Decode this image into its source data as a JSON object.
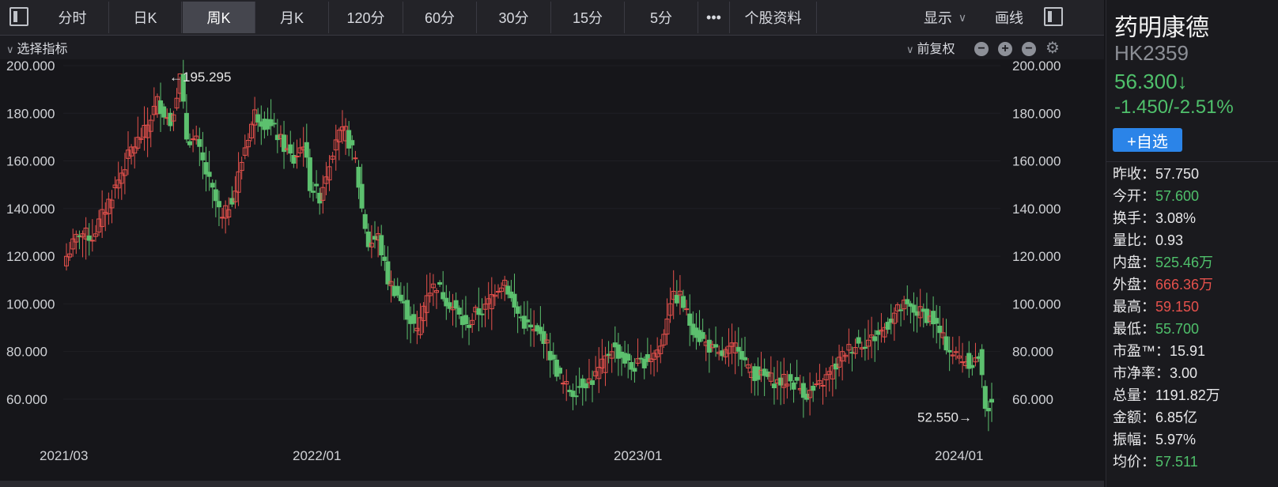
{
  "toolbar": {
    "tabs": [
      "分时",
      "日K",
      "周K",
      "月K",
      "120分",
      "60分",
      "30分",
      "15分",
      "5分"
    ],
    "active_tab": "周K",
    "more": "•••",
    "profile": "个股资料",
    "display": "显示",
    "draw": "画线"
  },
  "indicator_bar": {
    "select_label": "选择指标",
    "adjust_label": "前复权"
  },
  "stock": {
    "name": "药明康德",
    "code": "HK2359",
    "price": "56.300↓",
    "change": "-1.450/-2.51%",
    "watch_button": "+自选"
  },
  "quote_table": [
    {
      "label": "昨收",
      "value": "57.750",
      "color": "white"
    },
    {
      "label": "今开",
      "value": "57.600",
      "color": "green"
    },
    {
      "label": "换手",
      "value": "3.08%",
      "color": "white"
    },
    {
      "label": "量比",
      "value": "0.93",
      "color": "white"
    },
    {
      "label": "内盘",
      "value": "525.46万",
      "color": "green"
    },
    {
      "label": "外盘",
      "value": "666.36万",
      "color": "red"
    },
    {
      "label": "最高",
      "value": "59.150",
      "color": "red"
    },
    {
      "label": "最低",
      "value": "55.700",
      "color": "green"
    },
    {
      "label": "市盈™",
      "value": "15.91",
      "color": "white"
    },
    {
      "label": "市净率",
      "value": "3.00",
      "color": "white"
    },
    {
      "label": "总量",
      "value": "1191.82万",
      "color": "white"
    },
    {
      "label": "金额",
      "value": "6.85亿",
      "color": "white"
    },
    {
      "label": "振幅",
      "value": "5.97%",
      "color": "white"
    },
    {
      "label": "均价",
      "value": "57.511",
      "color": "green"
    }
  ],
  "colors": {
    "up": "#e5514c",
    "down": "#5cc06e",
    "bg": "#16161a"
  },
  "chart_data": {
    "type": "candlestick",
    "ylim": [
      50,
      200
    ],
    "y_ticks": [
      "200.000",
      "180.000",
      "160.000",
      "140.000",
      "120.000",
      "100.000",
      "80.000",
      "60.000"
    ],
    "x_ticks": [
      "2021/03",
      "2022/01",
      "2023/01",
      "2024/01"
    ],
    "annotations": {
      "high": "←195.295",
      "low": "52.550→"
    },
    "anchors": [
      [
        0,
        120
      ],
      [
        4,
        130
      ],
      [
        8,
        128
      ],
      [
        12,
        140
      ],
      [
        16,
        152
      ],
      [
        20,
        165
      ],
      [
        24,
        172
      ],
      [
        28,
        185
      ],
      [
        32,
        176
      ],
      [
        35,
        195
      ],
      [
        37,
        170
      ],
      [
        40,
        168
      ],
      [
        43,
        155
      ],
      [
        46,
        143
      ],
      [
        48,
        135
      ],
      [
        52,
        148
      ],
      [
        55,
        166
      ],
      [
        58,
        180
      ],
      [
        61,
        176
      ],
      [
        64,
        173
      ],
      [
        67,
        166
      ],
      [
        70,
        160
      ],
      [
        73,
        168
      ],
      [
        75,
        150
      ],
      [
        78,
        145
      ],
      [
        80,
        155
      ],
      [
        83,
        170
      ],
      [
        86,
        172
      ],
      [
        89,
        160
      ],
      [
        91,
        140
      ],
      [
        93,
        125
      ],
      [
        96,
        128
      ],
      [
        99,
        110
      ],
      [
        102,
        104
      ],
      [
        105,
        96
      ],
      [
        108,
        88
      ],
      [
        111,
        105
      ],
      [
        114,
        108
      ],
      [
        117,
        102
      ],
      [
        120,
        97
      ],
      [
        123,
        90
      ],
      [
        126,
        96
      ],
      [
        129,
        98
      ],
      [
        132,
        106
      ],
      [
        135,
        110
      ],
      [
        138,
        98
      ],
      [
        141,
        92
      ],
      [
        144,
        88
      ],
      [
        147,
        86
      ],
      [
        150,
        75
      ],
      [
        153,
        66
      ],
      [
        156,
        63
      ],
      [
        159,
        67
      ],
      [
        162,
        68
      ],
      [
        165,
        74
      ],
      [
        168,
        82
      ],
      [
        171,
        78
      ],
      [
        174,
        73
      ],
      [
        177,
        75
      ],
      [
        180,
        78
      ],
      [
        183,
        82
      ],
      [
        186,
        102
      ],
      [
        189,
        103
      ],
      [
        192,
        92
      ],
      [
        195,
        86
      ],
      [
        198,
        82
      ],
      [
        201,
        78
      ],
      [
        204,
        80
      ],
      [
        207,
        83
      ],
      [
        210,
        72
      ],
      [
        213,
        70
      ],
      [
        216,
        69
      ],
      [
        219,
        67
      ],
      [
        222,
        68
      ],
      [
        225,
        66
      ],
      [
        228,
        62
      ],
      [
        231,
        64
      ],
      [
        234,
        69
      ],
      [
        237,
        74
      ],
      [
        240,
        80
      ],
      [
        243,
        83
      ],
      [
        246,
        84
      ],
      [
        249,
        86
      ],
      [
        252,
        90
      ],
      [
        255,
        96
      ],
      [
        258,
        99
      ],
      [
        261,
        97
      ],
      [
        264,
        96
      ],
      [
        267,
        93
      ],
      [
        270,
        85
      ],
      [
        273,
        79
      ],
      [
        276,
        77
      ],
      [
        279,
        75
      ],
      [
        281,
        78
      ],
      [
        283,
        58
      ],
      [
        285,
        56
      ]
    ]
  }
}
